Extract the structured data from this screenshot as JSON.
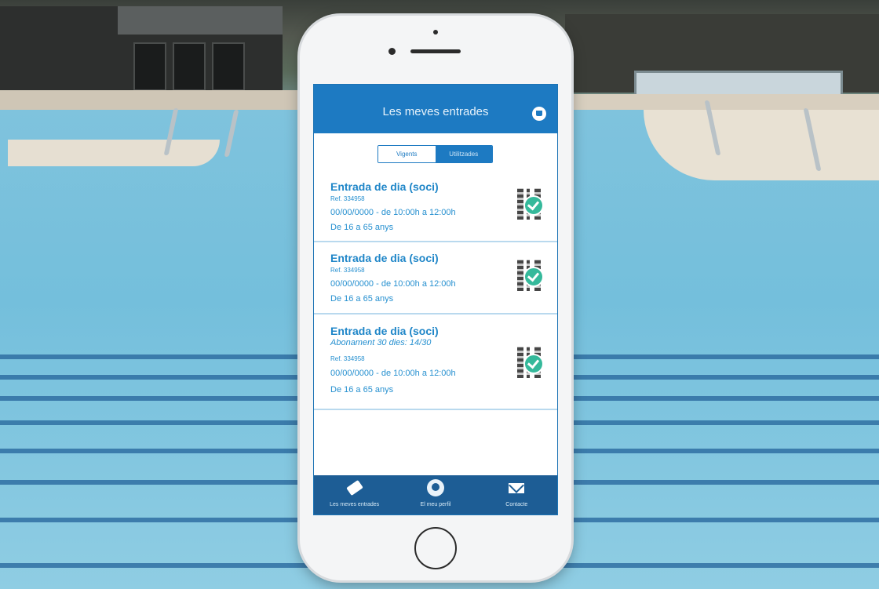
{
  "app": {
    "title": "Les meves entrades",
    "tabs": [
      {
        "label": "Vigents",
        "active": true
      },
      {
        "label": "Utilitzades",
        "active": false
      }
    ]
  },
  "tickets": [
    {
      "name": "Entrada de dia (soci)",
      "subtitle": "",
      "ref": "Ref. 334958",
      "date": "00/00/0000 - de 10:00h a 12:00h",
      "age": "De 16 a 65 anys"
    },
    {
      "name": "Entrada de dia (soci)",
      "subtitle": "",
      "ref": "Ref. 334958",
      "date": "00/00/0000 - de 10:00h a 12:00h",
      "age": "De 16 a 65 anys"
    },
    {
      "name": "Entrada de dia (soci)",
      "subtitle": "Abonament 30 dies: 14/30",
      "ref": "Ref. 334958",
      "date": "00/00/0000 - de 10:00h a 12:00h",
      "age": "De 16 a 65 anys"
    }
  ],
  "bottom_nav": [
    {
      "label": "Les meves entrades",
      "icon": "ticket-icon"
    },
    {
      "label": "El meu perfil",
      "icon": "profile-icon"
    },
    {
      "label": "Contacte",
      "icon": "mail-icon"
    }
  ],
  "colors": {
    "primary": "#1d7ac2",
    "nav": "#1d5d95",
    "text_accent": "#1f86c8",
    "check": "#35b99b"
  }
}
